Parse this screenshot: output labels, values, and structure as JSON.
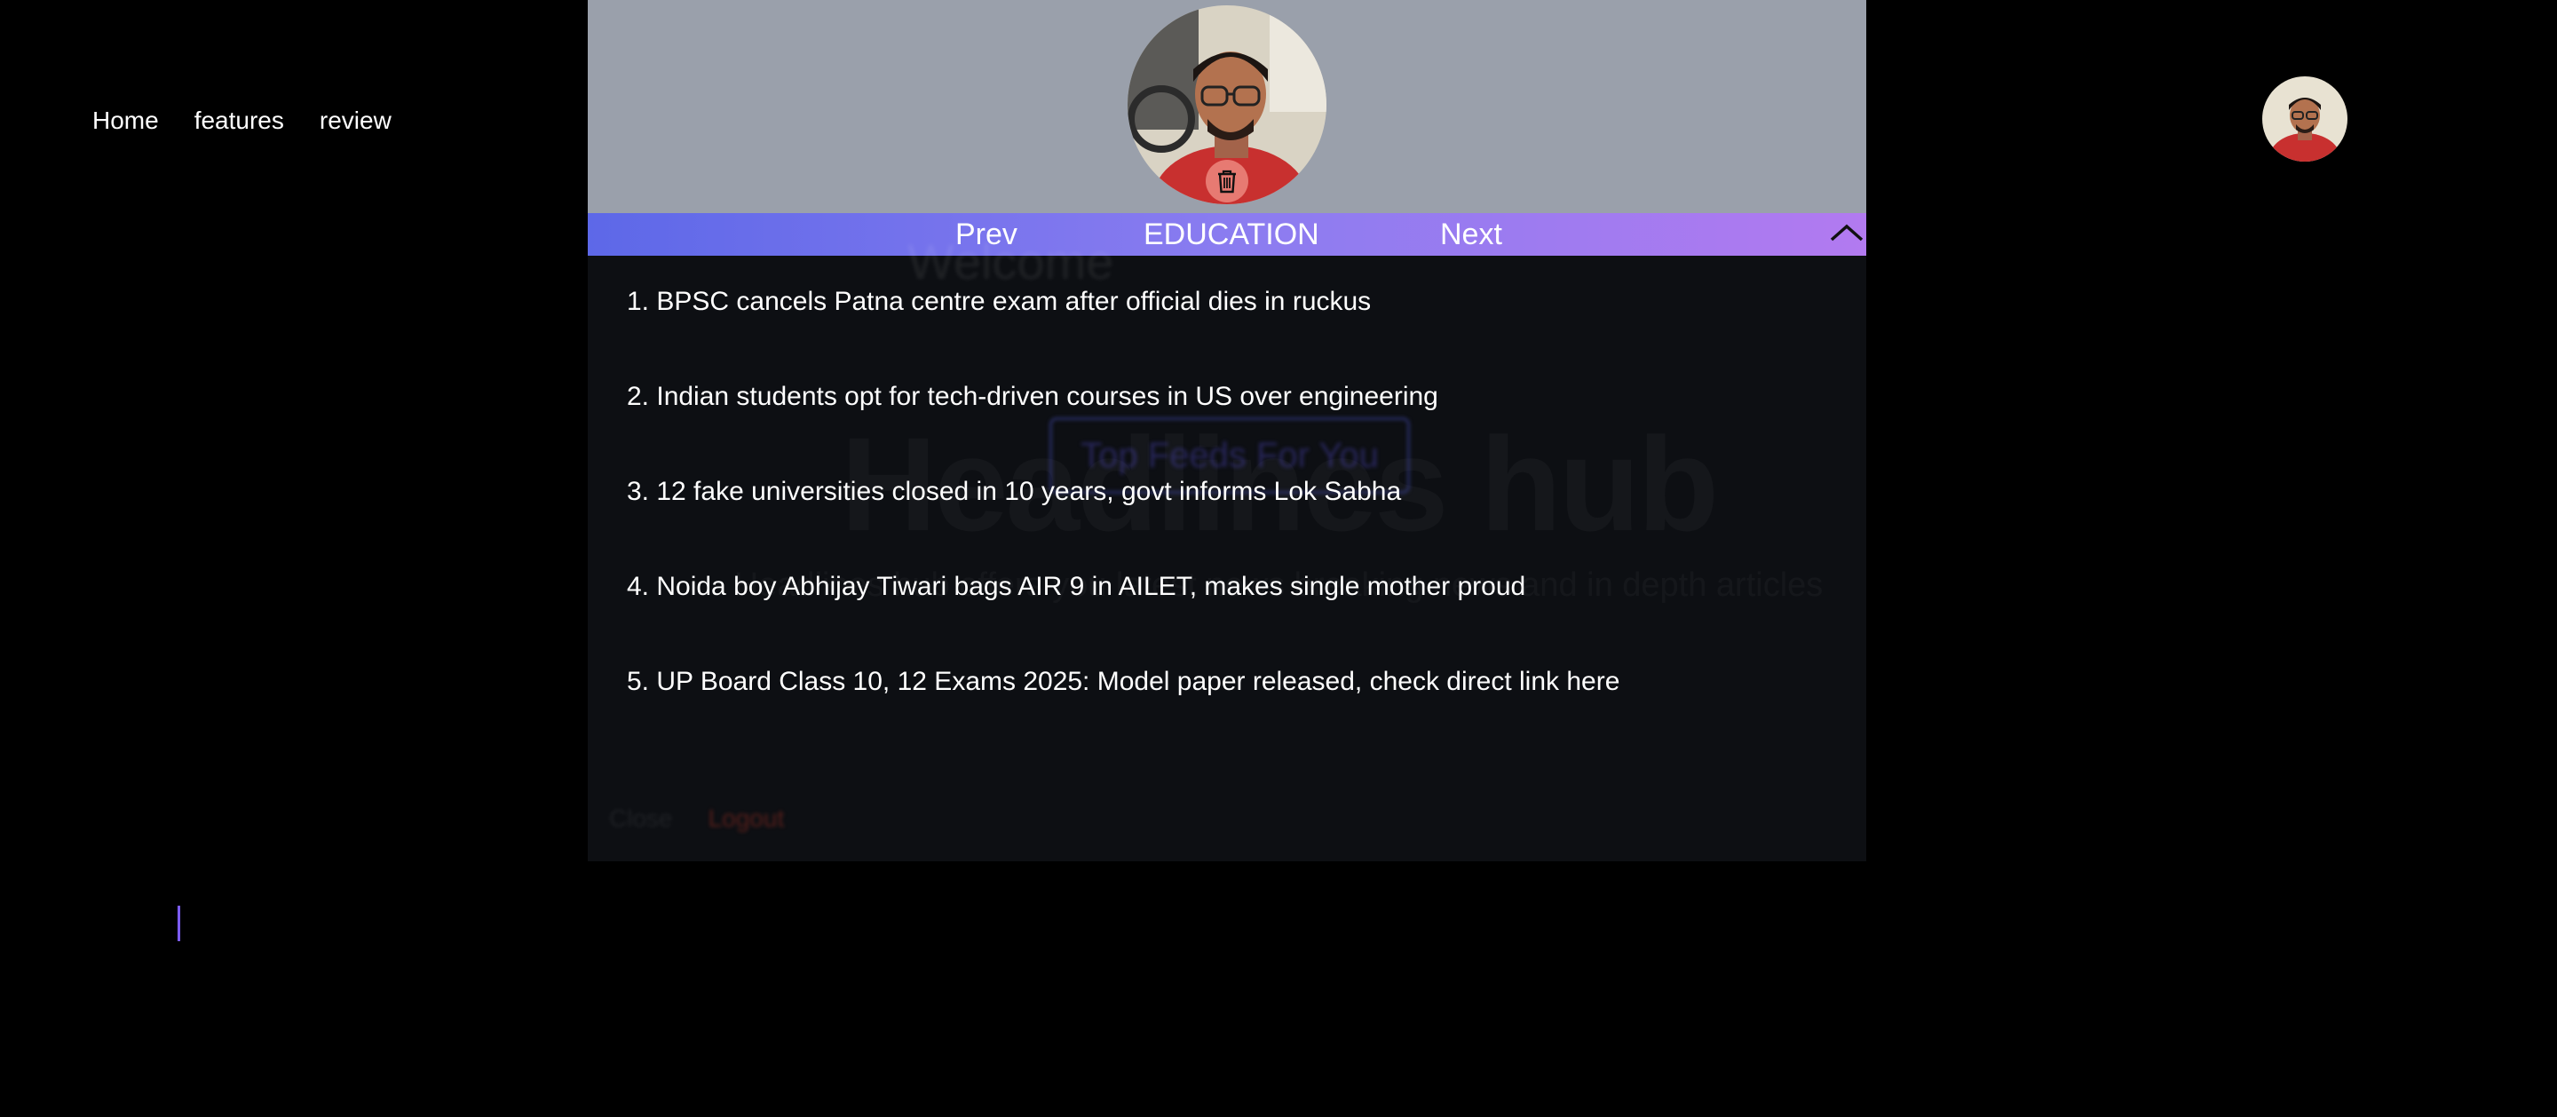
{
  "nav": {
    "home": "Home",
    "features": "features",
    "review": "review"
  },
  "hero": {
    "title": "Headlines hub",
    "subtitle": "Headlines hub offers you latest news breaking news and in depth articles"
  },
  "panel": {
    "prev": "Prev",
    "category": "EDUCATION",
    "next": "Next",
    "ghost_welcome": "Welcome",
    "ghost_button": "Top Feeds For You",
    "ghost_links": [
      "Close",
      "Logout"
    ],
    "news": [
      "1. BPSC cancels Patna centre exam after official dies in ruckus",
      "2. Indian students opt for tech-driven courses in US over engineering",
      "3. 12 fake universities closed in 10 years, govt informs Lok Sabha",
      "4. Noida boy Abhijay Tiwari bags AIR 9 in AILET, makes single mother proud",
      "5. UP Board Class 10, 12 Exams 2025: Model paper released, check direct link here"
    ]
  },
  "colors": {
    "bar_start": "#5d68e8",
    "bar_end": "#b27af0",
    "panel_head": "#9aa0ab",
    "trash_bg": "#e77a72"
  },
  "icons": [
    "trash-icon",
    "chevron-up-icon",
    "avatar"
  ]
}
